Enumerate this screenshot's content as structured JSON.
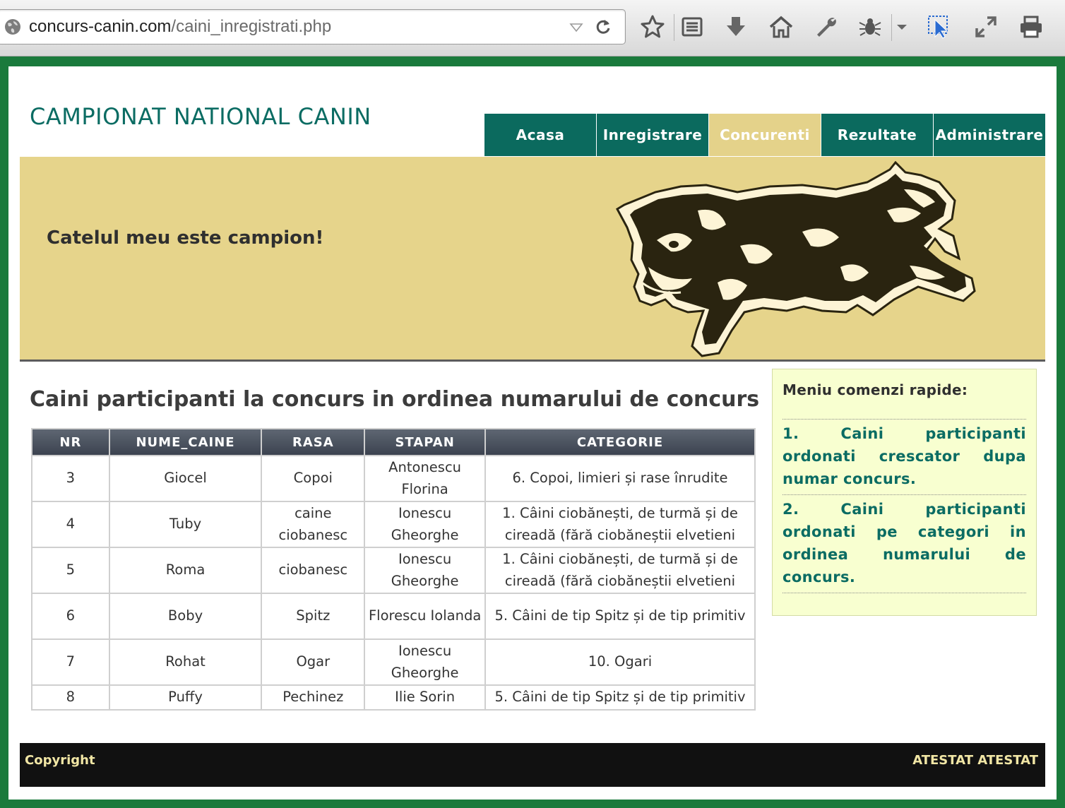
{
  "browser": {
    "url_domain": "concurs-canin.com",
    "url_path": "/caini_inregistrati.php"
  },
  "site": {
    "title": "CAMPIONAT NATIONAL CANIN",
    "nav": [
      "Acasa",
      "Inregistrare",
      "Concurenti",
      "Rezultate",
      "Administrare"
    ],
    "active_nav": "Concurenti",
    "slogan": "Catelul meu este campion!"
  },
  "main": {
    "heading": "Caini participanti la concurs in ordinea numarului de concurs",
    "columns": [
      "NR",
      "NUME_CAINE",
      "RASA",
      "STAPAN",
      "CATEGORIE"
    ],
    "rows": [
      {
        "nr": "3",
        "nume": "Giocel",
        "rasa": "Copoi",
        "stapan": "Antonescu Florina",
        "categorie": "6. Copoi, limieri și rase înrudite"
      },
      {
        "nr": "4",
        "nume": "Tuby",
        "rasa": "caine ciobanesc",
        "stapan": "Ionescu Gheorghe",
        "categorie": "1. Câini ciobănești, de turmă și de cireadă (fără ciobăneștii elvetieni"
      },
      {
        "nr": "5",
        "nume": "Roma",
        "rasa": "ciobanesc",
        "stapan": "Ionescu Gheorghe",
        "categorie": "1. Câini ciobănești, de turmă și de cireadă (fără ciobăneștii elvetieni"
      },
      {
        "nr": "6",
        "nume": "Boby",
        "rasa": "Spitz",
        "stapan": "Florescu Iolanda",
        "categorie": "5. Câini de tip Spitz și de tip primitiv"
      },
      {
        "nr": "7",
        "nume": "Rohat",
        "rasa": "Ogar",
        "stapan": "Ionescu Gheorghe",
        "categorie": "10. Ogari"
      },
      {
        "nr": "8",
        "nume": "Puffy",
        "rasa": "Pechinez",
        "stapan": "Ilie Sorin",
        "categorie": "5. Câini de tip Spitz și de tip primitiv"
      }
    ]
  },
  "sidebar": {
    "title": "Meniu comenzi rapide:",
    "links": [
      "1. Caini participanti ordonati crescator dupa numar concurs.",
      "2. Caini participanti ordonati pe categori in ordinea numarului de concurs."
    ]
  },
  "footer": {
    "left": "Copyright",
    "right": "ATESTAT ATESTAT"
  },
  "colors": {
    "nav_bg": "#0b6a5e",
    "nav_active": "#e4d28a",
    "banner_bg": "#e6d48b",
    "frame_green": "#1a7a3c",
    "sidebar_bg": "#f8ffd0",
    "footer_bg": "#111111"
  },
  "icons": [
    "globe-icon",
    "dropdown-arrow-icon",
    "reload-icon",
    "bookmark-star-icon",
    "reading-list-icon",
    "download-icon",
    "home-icon",
    "wrench-icon",
    "firebug-icon",
    "menu-dropdown-icon",
    "inspect-cursor-icon",
    "fullscreen-icon",
    "print-icon",
    "dog-illustration"
  ]
}
